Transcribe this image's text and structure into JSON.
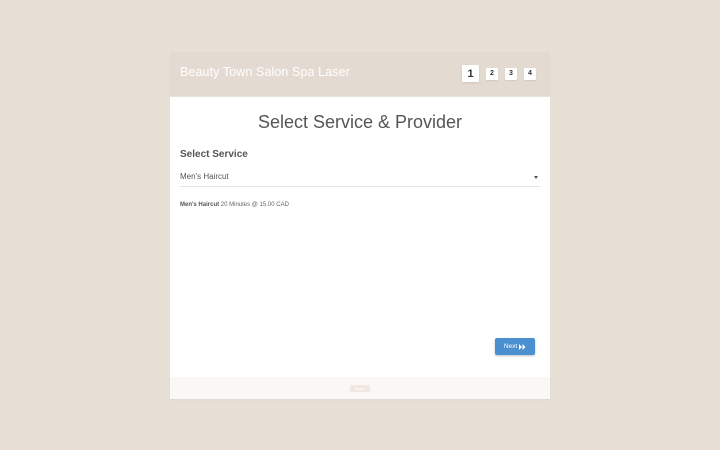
{
  "header": {
    "brand": "Beauty Town Salon Spa Laser",
    "steps": [
      "1",
      "2",
      "3",
      "4"
    ],
    "active_step": "1"
  },
  "main": {
    "title": "Select Service & Provider",
    "service_label": "Select Service",
    "service_value": "Men's Haircut",
    "description": {
      "name": "Men's Haircut",
      "details": "20 Minutes @ 15.00 CAD"
    },
    "next_label": "Next",
    "next_icon": "double-chevron-right-icon"
  },
  "footer": {
    "badge": "Bagel"
  },
  "colors": {
    "background": "#e8e0d7",
    "header": "#e3dbd1",
    "primary_button": "#4a8fcf"
  }
}
